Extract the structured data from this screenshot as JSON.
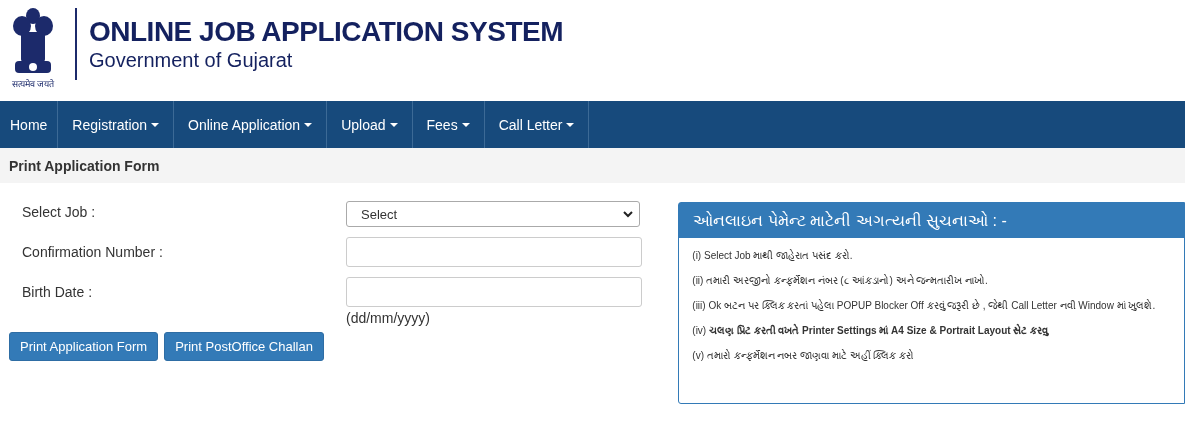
{
  "header": {
    "title": "ONLINE JOB APPLICATION SYSTEM",
    "subtitle": "Government of Gujarat",
    "emblem_motto": "सत्यमेव जयते"
  },
  "nav": [
    {
      "label": "Home",
      "dropdown": false
    },
    {
      "label": "Registration",
      "dropdown": true
    },
    {
      "label": "Online Application",
      "dropdown": true
    },
    {
      "label": "Upload",
      "dropdown": true
    },
    {
      "label": "Fees",
      "dropdown": true
    },
    {
      "label": "Call Letter",
      "dropdown": true
    }
  ],
  "page_title": "Print Application Form",
  "form": {
    "fields": [
      {
        "label": "Select Job :",
        "kind": "select",
        "value": "Select"
      },
      {
        "label": "Confirmation Number :",
        "kind": "text"
      },
      {
        "label": "Birth Date :",
        "kind": "text",
        "hint": "(dd/mm/yyyy)"
      }
    ],
    "buttons": [
      "Print Application Form",
      "Print PostOffice Challan"
    ]
  },
  "notice": {
    "title": "ઓનલાઇન પેમેન્ટ માટેની અગત્યની સુચનાઓ : -",
    "items": [
      "(i) Select Job માથી જાહેરાત પસંદ કરો.",
      "(ii) તમારી અરજીનો કન્ફર્મેશન નંબર (૮ આંકડાનો) અને જન્મતારીખ નાખો.",
      "(iii) Ok બટન પર ક્લિક કરતાં પહેલા POPUP Blocker Off કરવું જરૂરી છે , જેથી Call Letter નવી Window માં ખુલશે.",
      "(iv) **ચલણ પ્રિંટ કરતી વખતે Printer Settings માં A4 Size & Portrait Layout સેટ કરવુ**",
      "(v) તમારો કન્ફર્મેશન નબર જાણવા માટે અહીં ક્લિક કરો"
    ]
  }
}
